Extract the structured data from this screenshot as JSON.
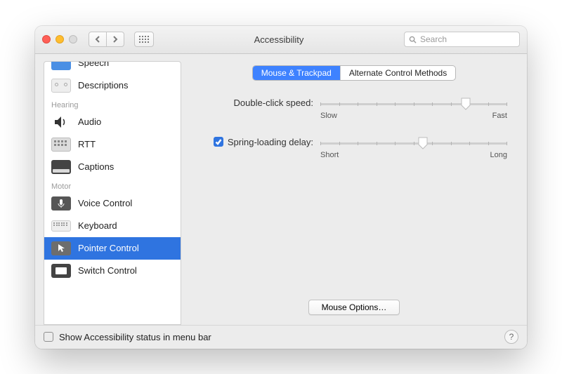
{
  "window": {
    "title": "Accessibility"
  },
  "search": {
    "placeholder": "Search"
  },
  "sidebar": {
    "sections": [
      {
        "header": null,
        "items": [
          {
            "id": "speech",
            "label": "Speech"
          },
          {
            "id": "descriptions",
            "label": "Descriptions"
          }
        ]
      },
      {
        "header": "Hearing",
        "items": [
          {
            "id": "audio",
            "label": "Audio"
          },
          {
            "id": "rtt",
            "label": "RTT"
          },
          {
            "id": "captions",
            "label": "Captions"
          }
        ]
      },
      {
        "header": "Motor",
        "items": [
          {
            "id": "voice-control",
            "label": "Voice Control"
          },
          {
            "id": "keyboard",
            "label": "Keyboard"
          },
          {
            "id": "pointer-control",
            "label": "Pointer Control",
            "selected": true
          },
          {
            "id": "switch-control",
            "label": "Switch Control"
          }
        ]
      }
    ]
  },
  "tabs": {
    "mouse_trackpad": "Mouse & Trackpad",
    "alternate": "Alternate Control Methods"
  },
  "controls": {
    "double_click": {
      "label": "Double-click speed:",
      "min": "Slow",
      "max": "Fast",
      "value_pct": 78
    },
    "spring": {
      "checked": true,
      "label": "Spring-loading delay:",
      "min": "Short",
      "max": "Long",
      "value_pct": 55
    }
  },
  "buttons": {
    "mouse_options": "Mouse Options…"
  },
  "footer": {
    "show_status_label": "Show Accessibility status in menu bar",
    "help": "?"
  }
}
